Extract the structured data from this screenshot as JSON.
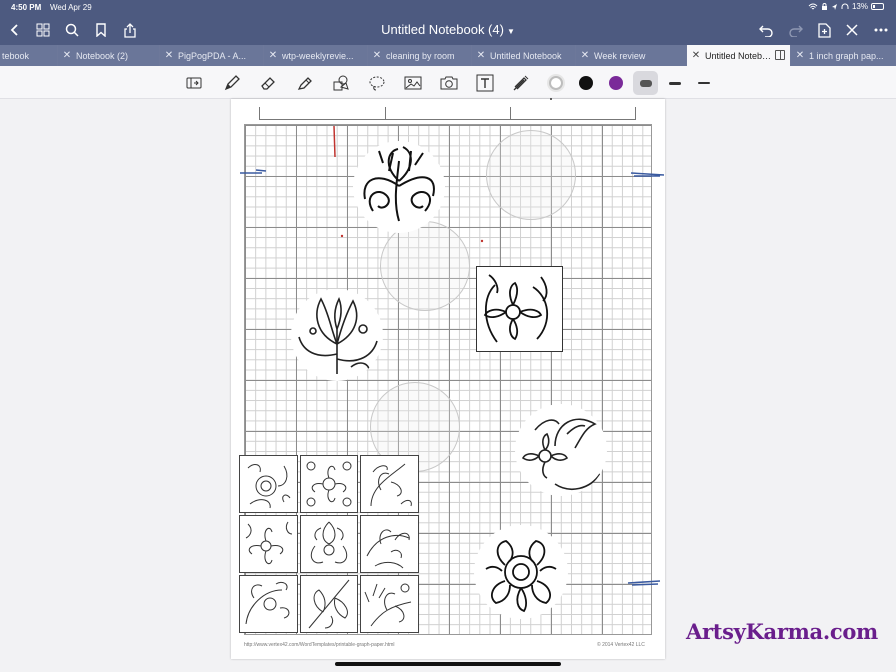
{
  "status_bar": {
    "time": "4:50 PM",
    "date": "Wed Apr 29",
    "battery": "13%"
  },
  "nav": {
    "title": "Untitled Notebook (4)"
  },
  "tabs": [
    {
      "label": "tebook",
      "active": false
    },
    {
      "label": "Notebook (2)",
      "active": false
    },
    {
      "label": "PigPogPDA - A...",
      "active": false
    },
    {
      "label": "wtp-weeklyrevie...",
      "active": false
    },
    {
      "label": "cleaning by room",
      "active": false
    },
    {
      "label": "Untitled Notebook",
      "active": false
    },
    {
      "label": "Week review",
      "active": false
    },
    {
      "label": "Untitled Notebo...",
      "active": true
    },
    {
      "label": "1 inch graph pap...",
      "active": false
    }
  ],
  "toolbar": {
    "colors": {
      "white": "#ffffff",
      "black": "#111111",
      "purple": "#7a2a99"
    }
  },
  "page": {
    "footer_url": "http://www.vertex42.com/WordTemplates/printable-graph-paper.html",
    "footer_copyright": "© 2014 Vertex42 LLC"
  },
  "watermark": "ArtsyKarma.com",
  "colors": {
    "chrome": "#4d5a80",
    "tab_inactive": "#6a7699",
    "watermark": "#6a1e8c"
  }
}
